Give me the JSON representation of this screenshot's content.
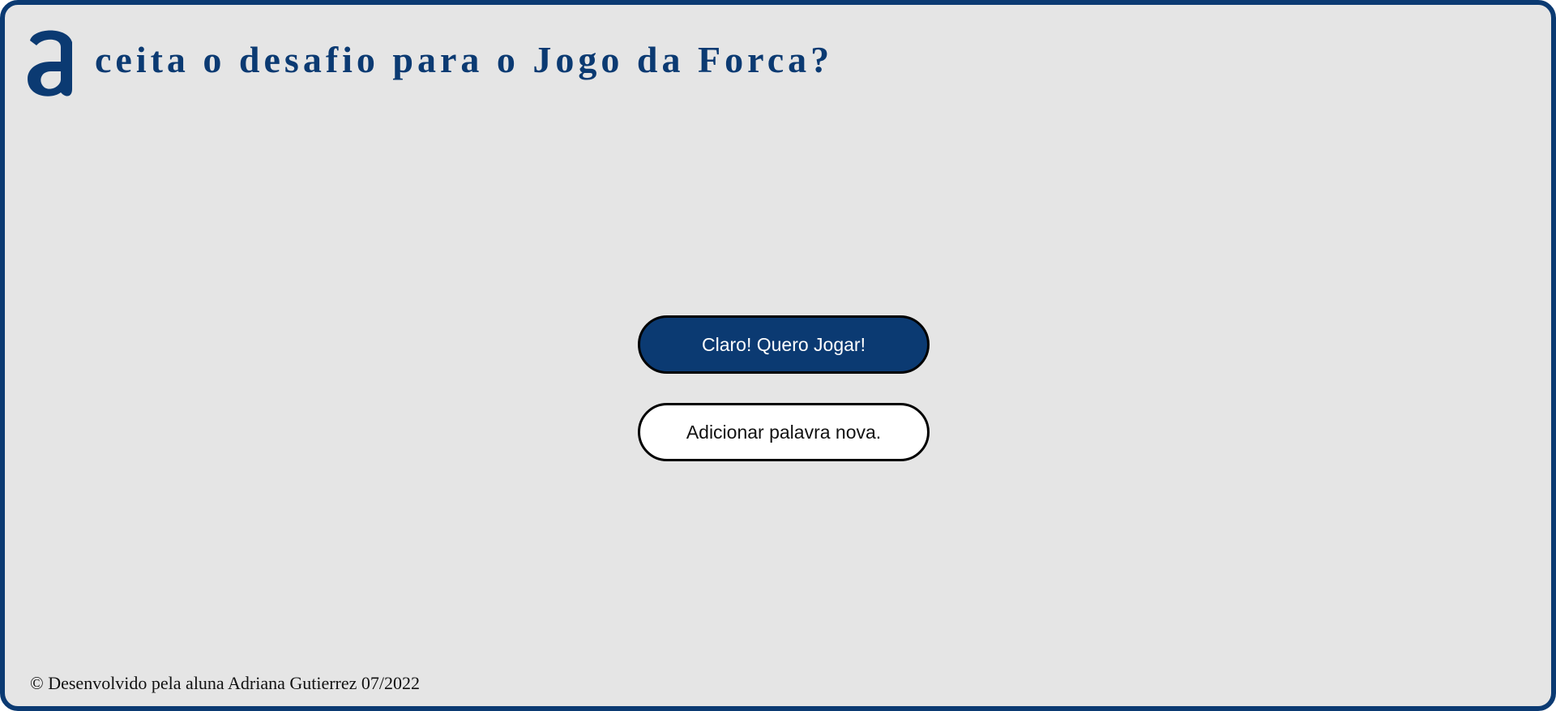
{
  "header": {
    "logo_letter": "a",
    "logo_icon": "letter-a-logo",
    "title": "ceita o desafio para o Jogo da Forca?"
  },
  "actions": {
    "play_label": "Claro! Quero Jogar!",
    "add_word_label": "Adicionar palavra nova."
  },
  "footer": {
    "text": "© Desenvolvido pela aluna Adriana Gutierrez 07/2022"
  },
  "colors": {
    "brand": "#0b3a72",
    "background": "#e5e5e5",
    "secondary_button": "#ffffff"
  }
}
